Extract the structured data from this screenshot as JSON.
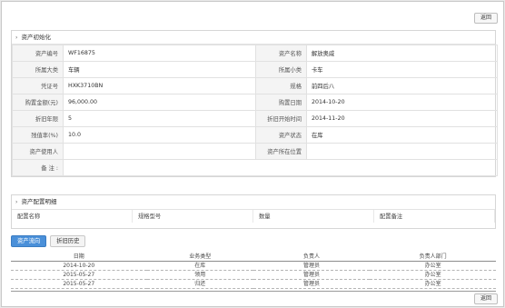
{
  "buttons": {
    "back_top": "返回",
    "back_bottom": "返回"
  },
  "init": {
    "title": "资产初始化",
    "rows": [
      [
        {
          "label": "资产编号",
          "value": "WF16875"
        },
        {
          "label": "资产名称",
          "value": "解放奥威"
        }
      ],
      [
        {
          "label": "所属大类",
          "value": "车辆"
        },
        {
          "label": "所属小类",
          "value": "卡车"
        }
      ],
      [
        {
          "label": "凭证号",
          "value": "HXK3710BN"
        },
        {
          "label": "规格",
          "value": "前四后八"
        }
      ],
      [
        {
          "label": "购置金额(元)",
          "value": "96,000.00"
        },
        {
          "label": "购置日期",
          "value": "2014-10-20"
        }
      ],
      [
        {
          "label": "折旧年限",
          "value": "5"
        },
        {
          "label": "折旧开始时间",
          "value": "2014-11-20"
        }
      ],
      [
        {
          "label": "残值率(%)",
          "value": "10.0"
        },
        {
          "label": "资产状态",
          "value": "在库"
        }
      ],
      [
        {
          "label": "资产使用人",
          "value": ""
        },
        {
          "label": "资产所在位置",
          "value": ""
        }
      ]
    ],
    "note_label": "备 注 :",
    "note_value": ""
  },
  "config": {
    "title": "资产配置明细",
    "columns": [
      "配置名称",
      "规格型号",
      "数量",
      "配置备注"
    ]
  },
  "tabs": [
    {
      "label": "资产流向",
      "active": true
    },
    {
      "label": "折旧历史",
      "active": false
    }
  ],
  "history": {
    "columns": [
      "日期",
      "业务类型",
      "负责人",
      "负责人部门"
    ],
    "rows": [
      [
        "2014-10-20",
        "在库",
        "管理员",
        "办公室"
      ],
      [
        "2015-05-27",
        "领用",
        "管理员",
        "办公室"
      ],
      [
        "2015-05-27",
        "归还",
        "管理员",
        "办公室"
      ]
    ]
  }
}
